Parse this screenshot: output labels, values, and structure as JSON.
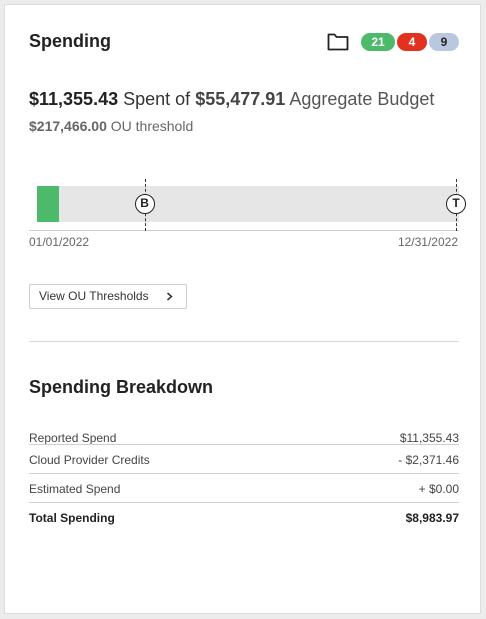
{
  "card": {
    "title": "Spending"
  },
  "badges": {
    "green": "21",
    "red": "4",
    "blue": "9"
  },
  "summary": {
    "spent": "$11,355.43",
    "spent_of": "Spent of",
    "budget": "$55,477.91",
    "budget_label": "Aggregate Budget",
    "threshold": "$217,466.00",
    "threshold_label": "OU threshold"
  },
  "timeline": {
    "start_date": "01/01/2022",
    "end_date": "12/31/2022",
    "budget_marker": "B",
    "threshold_marker": "T",
    "spent_fraction": 0.052,
    "budget_fraction": 0.255,
    "threshold_fraction": 1.0
  },
  "actions": {
    "view_thresholds": "View OU Thresholds"
  },
  "breakdown": {
    "title": "Spending Breakdown",
    "rows": [
      {
        "label": "Reported Spend",
        "value": "$11,355.43"
      },
      {
        "label": "Cloud Provider Credits",
        "value": "- $2,371.46"
      },
      {
        "label": "Estimated Spend",
        "value": "+ $0.00"
      },
      {
        "label": "Total Spending",
        "value": "$8,983.97"
      }
    ]
  },
  "colors": {
    "green": "#4cb96b",
    "red": "#e0321e",
    "blue": "#b9c8de"
  }
}
